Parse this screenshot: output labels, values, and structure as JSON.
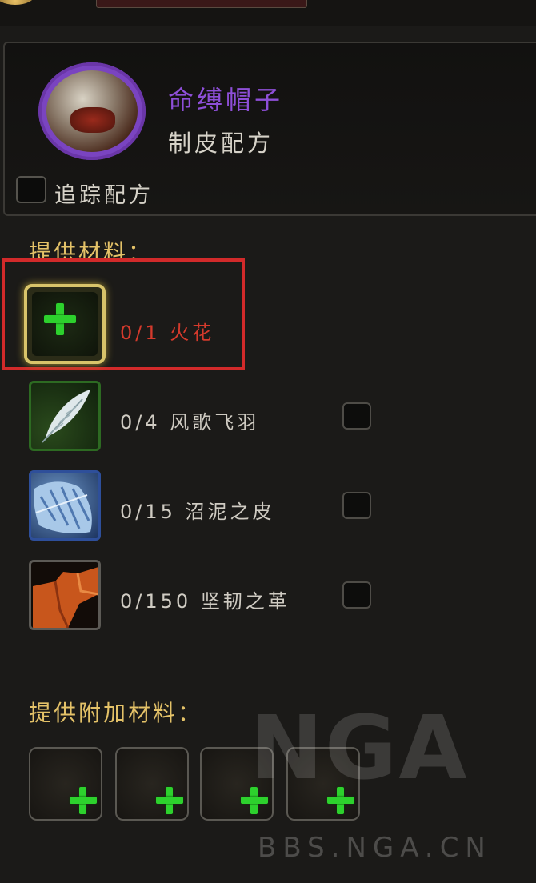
{
  "recipe": {
    "name": "命缚帽子",
    "type": "制皮配方",
    "icon": "dragon-skull-helmet-icon",
    "track_label": "追踪配方",
    "track_checked": false
  },
  "colors": {
    "recipe_name": "#8e4fd8",
    "section_title": "#e4c268",
    "missing_material": "#d43a2c",
    "highlight_box": "#d22a2a",
    "plus": "#2dd12d"
  },
  "reagents": {
    "title": "提供材料：",
    "items": [
      {
        "count": "0/1",
        "name": "火花",
        "icon": "add-plus-icon"
      },
      {
        "count": "0/4",
        "name": "风歌飞羽",
        "icon": "feather-icon"
      },
      {
        "count": "0/15",
        "name": "沼泥之皮",
        "icon": "blue-hide-icon"
      },
      {
        "count": "0/150",
        "name": "坚韧之革",
        "icon": "leather-icon"
      }
    ]
  },
  "optional": {
    "title": "提供附加材料：",
    "slot_count": 4
  },
  "watermark": {
    "logo": "NGA",
    "url": "BBS.NGA.CN"
  }
}
